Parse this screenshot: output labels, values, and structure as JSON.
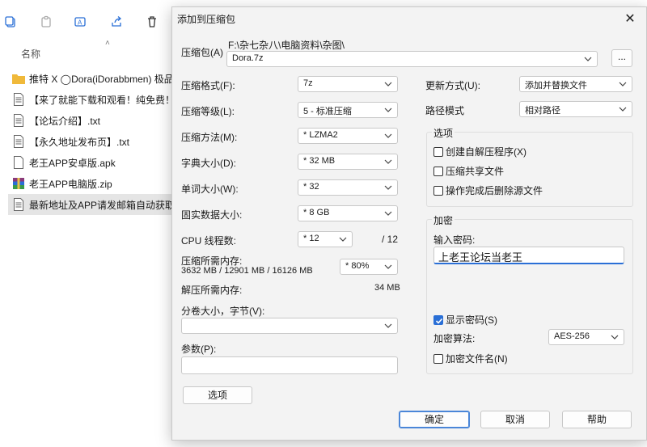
{
  "explorer": {
    "column_header": "名称",
    "files": [
      {
        "name": "推特 X ◯Dora(iDorabbmen) 极品…",
        "icon": "folder-icon",
        "selected": false
      },
      {
        "name": "【来了就能下载和观看！纯免费！】",
        "icon": "text-file-icon",
        "selected": false
      },
      {
        "name": "【论坛介绍】.txt",
        "icon": "text-file-icon",
        "selected": false
      },
      {
        "name": "【永久地址发布页】.txt",
        "icon": "text-file-icon",
        "selected": false
      },
      {
        "name": "老王APP安卓版.apk",
        "icon": "file-icon",
        "selected": false
      },
      {
        "name": "老王APP电脑版.zip",
        "icon": "archive-icon",
        "selected": false
      },
      {
        "name": "最新地址及APP请发邮箱自动获取!",
        "icon": "text-file-icon",
        "selected": true
      }
    ]
  },
  "dialog": {
    "title": "添加到压缩包",
    "archive_label": "压缩包(A)",
    "archive_path": "F:\\杂七杂八\\电脑资料\\杂图\\",
    "archive_name": "Dora.7z",
    "browse_label": "...",
    "left": {
      "format_label": "压缩格式(F):",
      "format_value": "7z",
      "level_label": "压缩等级(L):",
      "level_value": "5 - 标准压缩",
      "method_label": "压缩方法(M):",
      "method_value": "* LZMA2",
      "dict_label": "字典大小(D):",
      "dict_value": "* 32 MB",
      "word_label": "单词大小(W):",
      "word_value": "* 32",
      "solid_label": "固实数据大小:",
      "solid_value": "* 8 GB",
      "cpu_label": "CPU 线程数:",
      "cpu_value": "* 12",
      "cpu_total": "/ 12",
      "mem_label": "压缩所需内存:",
      "mem_detail": "3632 MB / 12901 MB / 16126 MB",
      "mem_percent": "* 80%",
      "decomp_label": "解压所需内存:",
      "decomp_value": "34 MB",
      "volume_label": "分卷大小，字节(V):",
      "volume_value": "",
      "params_label": "参数(P):",
      "params_value": "",
      "options_button": "选项"
    },
    "right": {
      "update_label": "更新方式(U):",
      "update_value": "添加并替换文件",
      "path_label": "路径模式",
      "path_value": "相对路径",
      "options_group": "选项",
      "opt_sfx": "创建自解压程序(X)",
      "opt_shared": "压缩共享文件",
      "opt_delete": "操作完成后删除源文件",
      "encryption_group": "加密",
      "password_label": "输入密码:",
      "password_value": "上老王论坛当老王",
      "show_password": "显示密码(S)",
      "method_label": "加密算法:",
      "method_value": "AES-256",
      "encrypt_names": "加密文件名(N)"
    },
    "buttons": {
      "ok": "确定",
      "cancel": "取消",
      "help": "帮助"
    }
  },
  "colors": {
    "accent": "#2a6fd6",
    "folder": "#f0b93a",
    "archive": "#8b3a7a"
  }
}
